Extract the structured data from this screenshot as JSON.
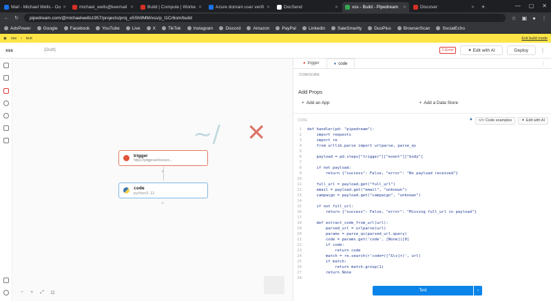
{
  "browser": {
    "tabs": [
      {
        "label": "Mail - Michael Wells - Ou",
        "color": "#1a73e8"
      },
      {
        "label": "michael_wells@keemail",
        "color": "#d93025"
      },
      {
        "label": "Build | Compute | Worke",
        "color": "#d93025"
      },
      {
        "label": "Azure domain user verifi",
        "color": "#1a73e8"
      },
      {
        "label": "DocSend",
        "color": "#ffffff"
      },
      {
        "label": "xss - Build - Pipedream",
        "color": "#34a853"
      },
      {
        "label": "Discover",
        "color": "#d93025"
      }
    ],
    "url": "pipedream.com/@michaelwells1957/projects/proj_e5Sh9MM/xss/p_t1Cr6om/build",
    "bookmarks": [
      "AdsPower",
      "Google",
      "Facebook",
      "YouTube",
      "Live",
      "X",
      "TikTok",
      "Instagram",
      "Discord",
      "Amazon",
      "PayPal",
      "Linkedin",
      "SaleSmartly",
      "DuoPlus",
      "BrowserScan",
      "SocialEcho"
    ]
  },
  "banner": {
    "crumb1": "xss",
    "crumb2": "test",
    "right_link": "Exit build mode"
  },
  "header": {
    "workflow_name": "xss",
    "status": "Draft",
    "error_badge": "1 Error",
    "edit_ai_label": "Edit with AI",
    "deploy_label": "Deploy"
  },
  "canvas": {
    "trigger": {
      "title": "trigger",
      "subtitle": "https://pdgpcoe0xxxxxx..."
    },
    "code": {
      "title": "code",
      "subtitle": "python3.12"
    }
  },
  "panel": {
    "tabs": [
      "trigger",
      "code"
    ],
    "section_label": "CONFIGURE",
    "props_title": "Add Props",
    "add_app": "Add an App",
    "add_datastore": "Add a Data Store",
    "code_lang": "CODE",
    "code_examples": "Code examples",
    "edit_ai": "Edit with AI",
    "test_label": "Test",
    "code_lines": [
      "def handler(pd: \"pipedream\"):",
      "    import requests",
      "    import re",
      "    from urllib.parse import urlparse, parse_qs",
      "",
      "    payload = pd.steps[\"trigger\"][\"event\"][\"body\"]",
      "",
      "    if not payload:",
      "        return {\"success\": False, \"error\": \"No payload received\"}",
      "",
      "    full_url = payload.get(\"full_url\")",
      "    email = payload.get(\"email\", \"unknown\")",
      "    campaign = payload.get(\"campaign\", \"unknown\")",
      "",
      "    if not full_url:",
      "        return {\"success\": False, \"error\": \"Missing full_url in payload\"}",
      "",
      "    def extract_code_from_url(url):",
      "        parsed_url = urlparse(url)",
      "        params = parse_qs(parsed_url.query)",
      "        code = params.get('code', [None])[0]",
      "        if code:",
      "            return code",
      "        match = re.search(r'code=([^&\\s]+)', url)",
      "        if match:",
      "            return match.group(1)",
      "        return None",
      ""
    ]
  }
}
